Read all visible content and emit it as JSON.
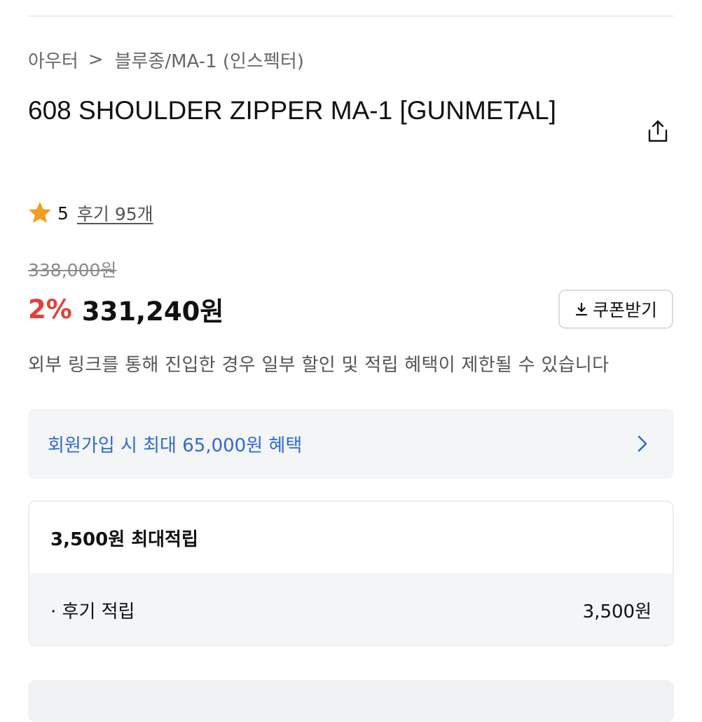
{
  "breadcrumb": {
    "parent": "아우터",
    "separator": ">",
    "current": "블루종/MA-1 (인스펙터)"
  },
  "product": {
    "title": "608 SHOULDER ZIPPER MA-1 [GUNMETAL]"
  },
  "rating": {
    "icon": "star-icon",
    "score": "5",
    "reviews_link": "후기 95개",
    "stars": 5
  },
  "price": {
    "original": "338,000원",
    "discount_rate": "2%",
    "sale": "331,240원"
  },
  "coupon": {
    "label": "쿠폰받기",
    "icon": "download-icon"
  },
  "notice": "외부 링크를 통해 진입한 경우 일부 할인 및 적립 혜택이 제한될 수 있습니다",
  "signup_banner": {
    "text": "회원가입 시 최대 65,000원 혜택",
    "icon": "chevron-right-icon"
  },
  "points": {
    "header": "3,500원 최대적립",
    "rows": [
      {
        "label": "· 후기 적립",
        "value": "3,500원"
      }
    ]
  },
  "colors": {
    "accent_red": "#e0413a",
    "link_blue": "#2e6ad6",
    "star_orange": "#f39c1f",
    "panel_bg": "#f4f5f7"
  }
}
